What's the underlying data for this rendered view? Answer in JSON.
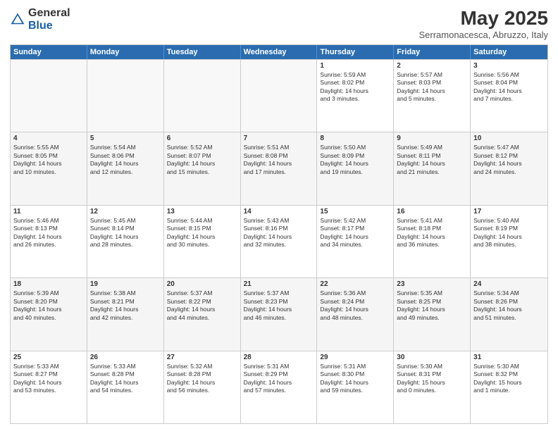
{
  "header": {
    "logo_general": "General",
    "logo_blue": "Blue",
    "title": "May 2025",
    "location": "Serramonacesca, Abruzzo, Italy"
  },
  "days_of_week": [
    "Sunday",
    "Monday",
    "Tuesday",
    "Wednesday",
    "Thursday",
    "Friday",
    "Saturday"
  ],
  "weeks": [
    [
      {
        "day": "",
        "info": ""
      },
      {
        "day": "",
        "info": ""
      },
      {
        "day": "",
        "info": ""
      },
      {
        "day": "",
        "info": ""
      },
      {
        "day": "1",
        "info": "Sunrise: 5:59 AM\nSunset: 8:02 PM\nDaylight: 14 hours\nand 3 minutes."
      },
      {
        "day": "2",
        "info": "Sunrise: 5:57 AM\nSunset: 8:03 PM\nDaylight: 14 hours\nand 5 minutes."
      },
      {
        "day": "3",
        "info": "Sunrise: 5:56 AM\nSunset: 8:04 PM\nDaylight: 14 hours\nand 7 minutes."
      }
    ],
    [
      {
        "day": "4",
        "info": "Sunrise: 5:55 AM\nSunset: 8:05 PM\nDaylight: 14 hours\nand 10 minutes."
      },
      {
        "day": "5",
        "info": "Sunrise: 5:54 AM\nSunset: 8:06 PM\nDaylight: 14 hours\nand 12 minutes."
      },
      {
        "day": "6",
        "info": "Sunrise: 5:52 AM\nSunset: 8:07 PM\nDaylight: 14 hours\nand 15 minutes."
      },
      {
        "day": "7",
        "info": "Sunrise: 5:51 AM\nSunset: 8:08 PM\nDaylight: 14 hours\nand 17 minutes."
      },
      {
        "day": "8",
        "info": "Sunrise: 5:50 AM\nSunset: 8:09 PM\nDaylight: 14 hours\nand 19 minutes."
      },
      {
        "day": "9",
        "info": "Sunrise: 5:49 AM\nSunset: 8:11 PM\nDaylight: 14 hours\nand 21 minutes."
      },
      {
        "day": "10",
        "info": "Sunrise: 5:47 AM\nSunset: 8:12 PM\nDaylight: 14 hours\nand 24 minutes."
      }
    ],
    [
      {
        "day": "11",
        "info": "Sunrise: 5:46 AM\nSunset: 8:13 PM\nDaylight: 14 hours\nand 26 minutes."
      },
      {
        "day": "12",
        "info": "Sunrise: 5:45 AM\nSunset: 8:14 PM\nDaylight: 14 hours\nand 28 minutes."
      },
      {
        "day": "13",
        "info": "Sunrise: 5:44 AM\nSunset: 8:15 PM\nDaylight: 14 hours\nand 30 minutes."
      },
      {
        "day": "14",
        "info": "Sunrise: 5:43 AM\nSunset: 8:16 PM\nDaylight: 14 hours\nand 32 minutes."
      },
      {
        "day": "15",
        "info": "Sunrise: 5:42 AM\nSunset: 8:17 PM\nDaylight: 14 hours\nand 34 minutes."
      },
      {
        "day": "16",
        "info": "Sunrise: 5:41 AM\nSunset: 8:18 PM\nDaylight: 14 hours\nand 36 minutes."
      },
      {
        "day": "17",
        "info": "Sunrise: 5:40 AM\nSunset: 8:19 PM\nDaylight: 14 hours\nand 38 minutes."
      }
    ],
    [
      {
        "day": "18",
        "info": "Sunrise: 5:39 AM\nSunset: 8:20 PM\nDaylight: 14 hours\nand 40 minutes."
      },
      {
        "day": "19",
        "info": "Sunrise: 5:38 AM\nSunset: 8:21 PM\nDaylight: 14 hours\nand 42 minutes."
      },
      {
        "day": "20",
        "info": "Sunrise: 5:37 AM\nSunset: 8:22 PM\nDaylight: 14 hours\nand 44 minutes."
      },
      {
        "day": "21",
        "info": "Sunrise: 5:37 AM\nSunset: 8:23 PM\nDaylight: 14 hours\nand 46 minutes."
      },
      {
        "day": "22",
        "info": "Sunrise: 5:36 AM\nSunset: 8:24 PM\nDaylight: 14 hours\nand 48 minutes."
      },
      {
        "day": "23",
        "info": "Sunrise: 5:35 AM\nSunset: 8:25 PM\nDaylight: 14 hours\nand 49 minutes."
      },
      {
        "day": "24",
        "info": "Sunrise: 5:34 AM\nSunset: 8:26 PM\nDaylight: 14 hours\nand 51 minutes."
      }
    ],
    [
      {
        "day": "25",
        "info": "Sunrise: 5:33 AM\nSunset: 8:27 PM\nDaylight: 14 hours\nand 53 minutes."
      },
      {
        "day": "26",
        "info": "Sunrise: 5:33 AM\nSunset: 8:28 PM\nDaylight: 14 hours\nand 54 minutes."
      },
      {
        "day": "27",
        "info": "Sunrise: 5:32 AM\nSunset: 8:28 PM\nDaylight: 14 hours\nand 56 minutes."
      },
      {
        "day": "28",
        "info": "Sunrise: 5:31 AM\nSunset: 8:29 PM\nDaylight: 14 hours\nand 57 minutes."
      },
      {
        "day": "29",
        "info": "Sunrise: 5:31 AM\nSunset: 8:30 PM\nDaylight: 14 hours\nand 59 minutes."
      },
      {
        "day": "30",
        "info": "Sunrise: 5:30 AM\nSunset: 8:31 PM\nDaylight: 15 hours\nand 0 minutes."
      },
      {
        "day": "31",
        "info": "Sunrise: 5:30 AM\nSunset: 8:32 PM\nDaylight: 15 hours\nand 1 minute."
      }
    ]
  ]
}
